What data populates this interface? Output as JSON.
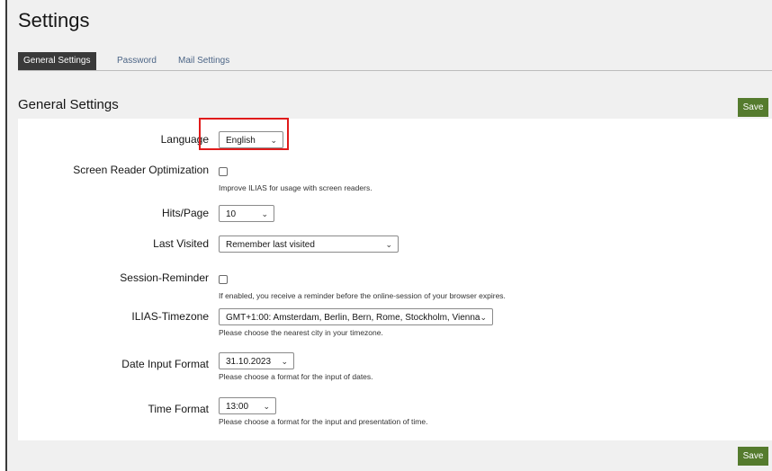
{
  "page": {
    "title": "Settings"
  },
  "tabs": [
    {
      "label": "General Settings",
      "active": true
    },
    {
      "label": "Password",
      "active": false
    },
    {
      "label": "Mail Settings",
      "active": false
    }
  ],
  "section": {
    "title": "General Settings",
    "save_label": "Save"
  },
  "form": {
    "language": {
      "label": "Language",
      "value": "English"
    },
    "screen_reader": {
      "label": "Screen Reader Optimization",
      "checked": false,
      "help": "Improve ILIAS for usage with screen readers."
    },
    "hits_page": {
      "label": "Hits/Page",
      "value": "10"
    },
    "last_visited": {
      "label": "Last Visited",
      "value": "Remember last visited"
    },
    "session_reminder": {
      "label": "Session-Reminder",
      "checked": false,
      "help": "If enabled, you receive a reminder before the online-session of your browser expires."
    },
    "timezone": {
      "label": "ILIAS-Timezone",
      "value": "GMT+1:00: Amsterdam, Berlin, Bern, Rome, Stockholm, Vienna",
      "help": "Please choose the nearest city in your timezone."
    },
    "date_format": {
      "label": "Date Input Format",
      "value": "31.10.2023",
      "help": "Please choose a format for the input of dates."
    },
    "time_format": {
      "label": "Time Format",
      "value": "13:00",
      "help": "Please choose a format for the input and presentation of time."
    }
  },
  "footer": {
    "save_label": "Save"
  },
  "colors": {
    "accent": "#557b2e",
    "highlight": "#e01b1b",
    "tab_active_bg": "#3a3a3a",
    "link": "#4c6586"
  },
  "icons": {
    "dropdown": "chevron-down-icon"
  }
}
